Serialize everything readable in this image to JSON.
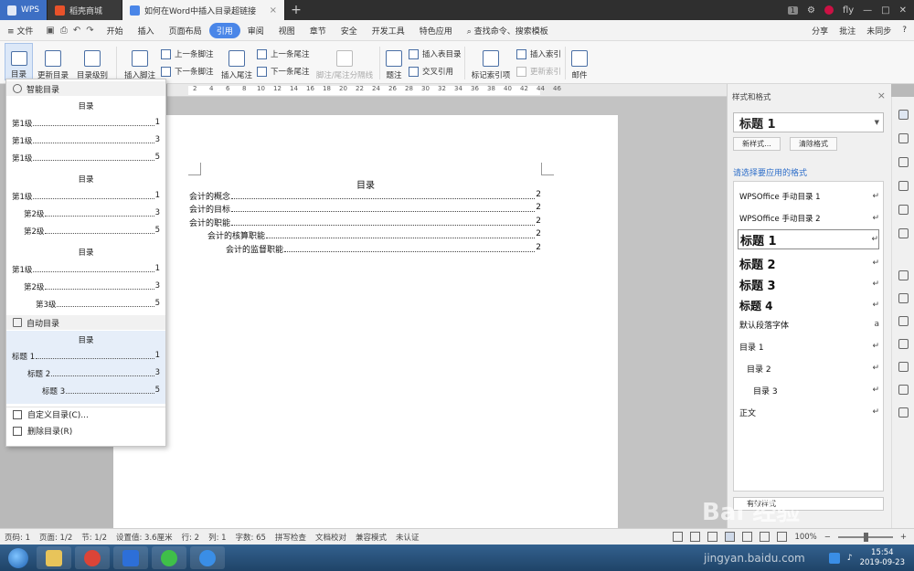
{
  "titlebar": {
    "tabs": [
      {
        "label": "WPS"
      },
      {
        "label": "稻壳商城"
      },
      {
        "label": "如何在Word中插入目录超链接"
      }
    ],
    "new_tab": "+",
    "page_badge": "1",
    "user": "fly"
  },
  "menubar": {
    "file": "≡ 文件",
    "items": [
      "开始",
      "插入",
      "页面布局",
      "引用",
      "审阅",
      "视图",
      "章节",
      "安全",
      "开发工具",
      "特色应用"
    ],
    "active_index": 3,
    "search": "查找命令、搜索模板",
    "right": [
      "分享",
      "批注",
      "未同步",
      "?"
    ]
  },
  "ribbon": {
    "toc": "目录",
    "update_toc": "更新目录",
    "toc_level": "目录级别",
    "insert_footnote": "插入脚注",
    "prev_footnote": "上一条脚注",
    "next_footnote": "下一条脚注",
    "insert_endnote": "插入尾注",
    "prev_endnote": "上一条尾注",
    "next_endnote": "下一条尾注",
    "footnote_sep": "脚注/尾注分隔线",
    "caption": "题注",
    "insert_table_toc": "插入表目录",
    "cross_ref": "交叉引用",
    "mark_index": "标记索引项",
    "insert_index": "插入索引",
    "update_index": "更新索引",
    "mail": "邮件"
  },
  "ruler": {
    "ticks": [
      "8",
      "6",
      "4",
      "2",
      "",
      "2",
      "4",
      "6",
      "8",
      "10",
      "12",
      "14",
      "16",
      "18",
      "20",
      "22",
      "24",
      "26",
      "28",
      "30",
      "32",
      "34",
      "36",
      "38",
      "40",
      "42",
      "44",
      "46"
    ]
  },
  "document": {
    "title": "目录",
    "entries": [
      {
        "text": "会计的概念",
        "page": "2",
        "level": 1
      },
      {
        "text": "会计的目标",
        "page": "2",
        "level": 1
      },
      {
        "text": "会计的职能",
        "page": "2",
        "level": 1
      },
      {
        "text": "会计的核算职能",
        "page": "2",
        "level": 2
      },
      {
        "text": "会计的监督职能",
        "page": "2",
        "level": 3
      }
    ]
  },
  "toc_dropdown": {
    "smart_header": "智能目录",
    "blocks": [
      {
        "title": "目录",
        "lines": [
          {
            "text": "第1级",
            "page": "1",
            "indent": 0
          },
          {
            "text": "第1级",
            "page": "3",
            "indent": 0
          },
          {
            "text": "第1级",
            "page": "5",
            "indent": 0
          }
        ]
      },
      {
        "title": "目录",
        "lines": [
          {
            "text": "第1级",
            "page": "1",
            "indent": 0
          },
          {
            "text": "第2级",
            "page": "3",
            "indent": 1
          },
          {
            "text": "第2级",
            "page": "5",
            "indent": 1
          }
        ]
      },
      {
        "title": "目录",
        "lines": [
          {
            "text": "第1级",
            "page": "1",
            "indent": 0
          },
          {
            "text": "第2级",
            "page": "3",
            "indent": 1
          },
          {
            "text": "第3级",
            "page": "5",
            "indent": 2
          }
        ]
      }
    ],
    "auto_header": "自动目录",
    "auto_block": {
      "title": "目录",
      "lines": [
        {
          "text": "标题 1",
          "page": "1",
          "indent": 0
        },
        {
          "text": "标题 2",
          "page": "3",
          "indent": 1
        },
        {
          "text": "标题 3",
          "page": "5",
          "indent": 2
        }
      ]
    },
    "custom": "自定义目录(C)...",
    "delete": "删除目录(R)"
  },
  "right_panel": {
    "header": "样式和格式",
    "current_style": "标题 1",
    "new_style": "新样式...",
    "clear_format": "清除格式",
    "prompt": "请选择要应用的格式",
    "styles": [
      {
        "name": "WPSOffice 手动目录 1",
        "mark": "↵",
        "size": 8.5,
        "bold": false,
        "indent": 0
      },
      {
        "name": "WPSOffice 手动目录 2",
        "mark": "↵",
        "size": 8.5,
        "bold": false,
        "indent": 0
      },
      {
        "name": "标题 1",
        "mark": "↵",
        "size": 13,
        "bold": true,
        "indent": 0
      },
      {
        "name": "标题 2",
        "mark": "↵",
        "size": 13,
        "bold": true,
        "indent": 0
      },
      {
        "name": "标题 3",
        "mark": "↵",
        "size": 13,
        "bold": true,
        "indent": 0
      },
      {
        "name": "标题 4",
        "mark": "↵",
        "size": 12,
        "bold": true,
        "indent": 0
      },
      {
        "name": "默认段落字体",
        "mark": "a",
        "size": 9,
        "bold": false,
        "indent": 0
      },
      {
        "name": "目录 1",
        "mark": "↵",
        "size": 9,
        "bold": false,
        "indent": 0
      },
      {
        "name": "目录 2",
        "mark": "↵",
        "size": 9,
        "bold": false,
        "indent": 8
      },
      {
        "name": "目录 3",
        "mark": "↵",
        "size": 9,
        "bold": false,
        "indent": 15
      },
      {
        "name": "正文",
        "mark": "↵",
        "size": 9,
        "bold": false,
        "indent": 0
      }
    ],
    "selected_style_index": 2,
    "show_label": "有效样式"
  },
  "statusbar": {
    "items": [
      "页码: 1",
      "页面: 1/2",
      "节: 1/2",
      "设置值: 3.6厘米",
      "行: 2",
      "列: 1",
      "字数: 65",
      "拼写检查",
      "文档校对",
      "兼容模式",
      "未认证"
    ],
    "zoom": "100%",
    "zoom_minus": "−",
    "zoom_plus": "+"
  },
  "taskbar": {
    "time": "15:54",
    "date": "2019-09-23"
  },
  "watermark": {
    "brand": "Bai 经验",
    "url": "jingyan.baidu.com"
  },
  "colors": {
    "accent": "#4a86e8",
    "link": "#2f6fc9",
    "wps_tab": "#3d6fc4",
    "shop_icon": "#e8522a"
  }
}
